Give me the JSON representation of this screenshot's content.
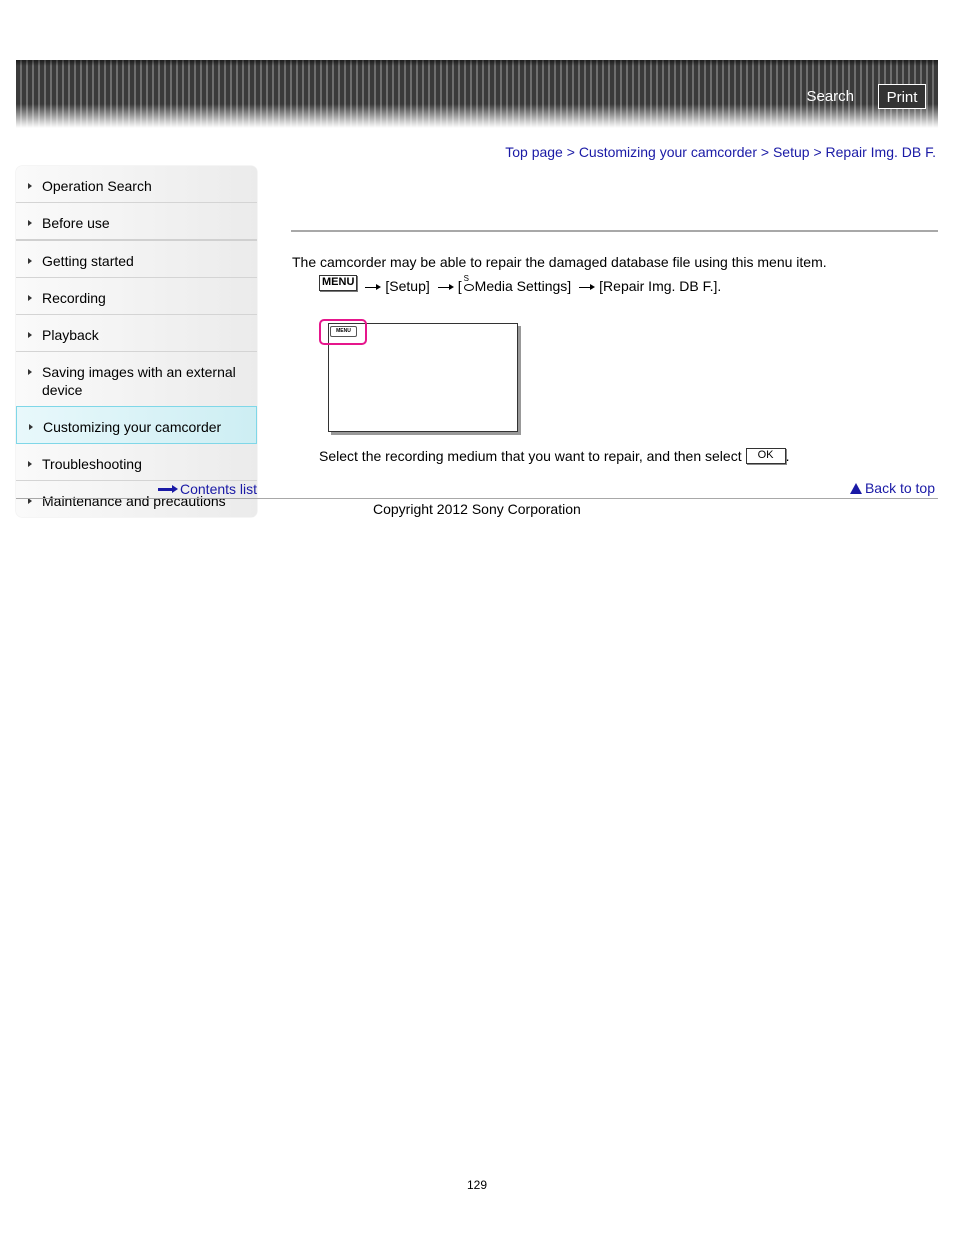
{
  "header": {
    "search_label": "Search",
    "print_label": "Print"
  },
  "breadcrumb": {
    "items": [
      "Top page",
      "Customizing your camcorder",
      "Setup",
      "Repair Img. DB F."
    ],
    "separator": ">"
  },
  "sidebar": {
    "items": [
      {
        "label": "Operation Search",
        "active": false
      },
      {
        "label": "Before use",
        "active": false
      },
      {
        "label": "Getting started",
        "active": false
      },
      {
        "label": "Recording",
        "active": false
      },
      {
        "label": "Playback",
        "active": false
      },
      {
        "label": "Saving images with an external device",
        "active": false
      },
      {
        "label": "Customizing your camcorder",
        "active": true
      },
      {
        "label": "Troubleshooting",
        "active": false
      },
      {
        "label": "Maintenance and precautions",
        "active": false
      }
    ],
    "contents_link": "Contents list",
    "active_color": "#7fd7e8"
  },
  "main": {
    "intro": "The camcorder may be able to repair the damaged database file using this menu item.",
    "path": {
      "menu_key": "MENU",
      "step1": "[Setup]",
      "step2_prefix": "[",
      "step2_label": "Media Settings]",
      "step3": "[Repair Img. DB F.]."
    },
    "figure": {
      "menu_label": "MENU",
      "highlight_color": "#e6168c"
    },
    "instruction": "Select the recording medium that you want to repair, and then select",
    "ok_label": "OK",
    "instruction_end": ".",
    "back_to_top": "Back to top"
  },
  "footer": {
    "copyright": "Copyright 2012 Sony Corporation",
    "page_number": "129"
  },
  "colors": {
    "link": "#1a1aa6"
  }
}
